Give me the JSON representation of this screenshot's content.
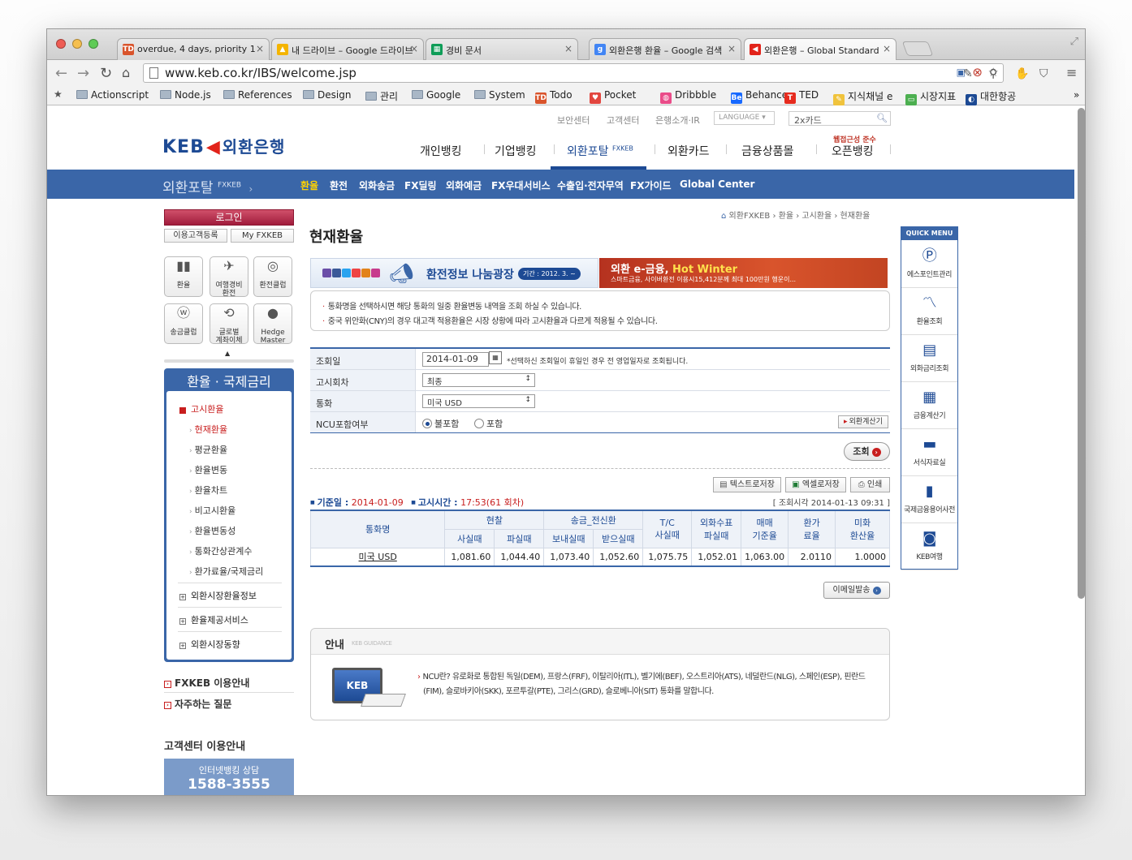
{
  "browser": {
    "tabs": [
      {
        "label": "overdue, 4 days, priority 1",
        "icon": "todoist-icon",
        "color": "#d9542c",
        "fav": "TD"
      },
      {
        "label": "내 드라이브 – Google 드라이브",
        "icon": "google-drive-icon",
        "color": "#f4b400",
        "fav": "▲"
      },
      {
        "label": "경비 문서",
        "icon": "google-sheets-icon",
        "color": "#0f9d58",
        "fav": "▦"
      },
      {
        "label": "외환은행 환율 – Google 검색",
        "icon": "google-icon",
        "color": "#4285f4",
        "fav": "g"
      },
      {
        "label": "외환은행 – Global Standard",
        "icon": "keb-icon",
        "color": "#e2231a",
        "fav": "◀"
      }
    ],
    "url": "www.keb.co.kr/IBS/welcome.jsp",
    "bookmarks": [
      "Actionscript",
      "Node.js",
      "References",
      "Design",
      "관리",
      "Google",
      "System",
      "Todo",
      "Pocket",
      "Dribbble",
      "Behance",
      "TED",
      "지식채널 e",
      "시장지표",
      "대한항공"
    ],
    "bookmarks_more": "»"
  },
  "site": {
    "util_links": [
      "보안센터",
      "고객센터",
      "은행소개·IR"
    ],
    "language": "LANGUAGE",
    "search_value": "2x카드",
    "logo_text": "KEB",
    "logo_kr": "외환은행",
    "gnb": [
      "개인뱅킹",
      "기업뱅킹",
      "외환포탈",
      "외환카드",
      "금융상품몰",
      "오픈뱅킹"
    ],
    "gnb_fxkeb": "FXKEB",
    "openbank_note": "웹접근성 준수",
    "portal_title": "외환포탈",
    "portal_sup": "FXKEB",
    "portal_arrow": "›",
    "subnav": [
      "환율",
      "환전",
      "외화송금",
      "FX딜링",
      "외화예금",
      "FX우대서비스",
      "수출입·전자무역",
      "FX가이드",
      "Global Center"
    ],
    "accent": "#3a66a8",
    "highlight": "#ffd200"
  },
  "sidebar": {
    "login": "로그인",
    "register": "이용고객등록",
    "my": "My FXKEB",
    "quick_icons": [
      {
        "label": "환율",
        "sym": "▮▮",
        "name": "exchange-rate-icon"
      },
      {
        "label": "여행경비\n환전",
        "sym": "✈",
        "name": "airplane-icon"
      },
      {
        "label": "환전클럽",
        "sym": "◎",
        "name": "exchange-club-icon"
      },
      {
        "label": "송금클럽",
        "sym": "ⓦ",
        "name": "remit-club-icon"
      },
      {
        "label": "글로벌\n계좌이체",
        "sym": "⟲",
        "name": "global-transfer-icon"
      },
      {
        "label": "Hedge\nMaster",
        "sym": "●",
        "name": "hedge-master-icon"
      }
    ],
    "up_arrow": "▲",
    "box_title": "환율 · 국제금리",
    "cat_open": "고시환율",
    "items": [
      "현재환율",
      "평균환율",
      "환율변동",
      "환율차트",
      "비고시환율",
      "환율변동성",
      "통화간상관계수",
      "환가료율/국제금리"
    ],
    "cats": [
      "외환시장환율정보",
      "환율제공서비스",
      "외환시장동향"
    ],
    "links": [
      "FXKEB 이용안내",
      "자주하는 질문"
    ],
    "cs_title": "고객센터 이용안내",
    "cs_line1": "인터넷뱅킹 상담",
    "cs_phone": "1588-3555"
  },
  "main": {
    "breadcrumb": "외환FXKEB › 환율 › 고시환율 › 현재환율",
    "title": "현재환율",
    "banner1_title": "환전정보 나눔광장",
    "banner1_period": "기간 : 2012. 3. ~",
    "banner2_title_a": "외환 e-금융, ",
    "banner2_title_b": "Hot Winter",
    "banner2_sub": "스마트금융, 사이버환전 이용시15,412분께 최대 100만원 행운이...",
    "notices": [
      "통화명을 선택하시면 해당 통화의 일중 환율변동 내역을 조회 하실 수 있습니다.",
      "중국 위안화(CNY)의 경우 대고객 적용환율은 시장 상황에 따라 고시환율과 다르게 적용될 수 있습니다."
    ],
    "form": {
      "date_label": "조회일",
      "date_value": "2014-01-09",
      "date_note": "*선택하신 조회일이 휴일인 경우 전 영업일자로 조회됩니다.",
      "round_label": "고시회차",
      "round_value": "최종",
      "currency_label": "통화",
      "currency_value": "미국 USD",
      "ncu_label": "NCU포함여부",
      "ncu_opt1": "불포함",
      "ncu_opt2": "포함",
      "calc": "외환계산기"
    },
    "query_btn": "조회",
    "actions": [
      "텍스트로저장",
      "엑셀로저장",
      "인쇄"
    ],
    "std_date_label": "기준일 :",
    "std_date": "2014-01-09",
    "std_time_label": "고시시간 :",
    "std_time": "17:53(61 회차)",
    "query_time": "[ 조회시각 2014-01-13 09:31 ]",
    "table": {
      "h_currency": "통화명",
      "h_cash": "현찰",
      "h_remit": "송금_전신환",
      "h_tc": "T/C\n사실때",
      "h_draft": "외화수표\n파실때",
      "h_base": "매매\n기준율",
      "h_fee": "환가\n료율",
      "h_usd": "미화\n환산율",
      "h_buy": "사실때",
      "h_sell": "파실때",
      "h_send": "보내실때",
      "h_recv": "받으실때",
      "rows": [
        {
          "currency": "미국 USD",
          "cash_buy": "1,081.60",
          "cash_sell": "1,044.40",
          "send": "1,073.40",
          "recv": "1,052.60",
          "tc": "1,075.75",
          "draft": "1,052.01",
          "base": "1,063.00",
          "fee": "2.0110",
          "usd": "1.0000"
        }
      ]
    },
    "mail_btn": "이메일발송",
    "guide_title": "안내",
    "guide_sub": "KEB GUIDANCE",
    "guide_img_text": "KEB",
    "guide_text": "NCU란? 유로화로 통합된 독일(DEM), 프랑스(FRF), 이탈리아(ITL), 벨기에(BEF), 오스트리아(ATS), 네덜란드(NLG), 스페인(ESP), 핀란드(FIM), 슬로바키아(SKK), 포르투갈(PTE), 그리스(GRD), 슬로베니아(SIT) 통화를 말합니다."
  },
  "quick_menu": {
    "title": "QUICK MENU",
    "items": [
      {
        "label": "에스포인트관리",
        "sym": "Ⓟ",
        "name": "spoint-icon"
      },
      {
        "label": "환율조회",
        "sym": "〽",
        "name": "rate-chart-icon"
      },
      {
        "label": "외화금리조회",
        "sym": "▤",
        "name": "interest-rate-icon"
      },
      {
        "label": "금융계산기",
        "sym": "▦",
        "name": "calculator-icon"
      },
      {
        "label": "서식자료실",
        "sym": "▬",
        "name": "forms-icon"
      },
      {
        "label": "국제금융용어사전",
        "sym": "▮",
        "name": "dictionary-icon"
      },
      {
        "label": "KEB여행",
        "sym": "◙",
        "name": "camera-icon"
      }
    ]
  }
}
